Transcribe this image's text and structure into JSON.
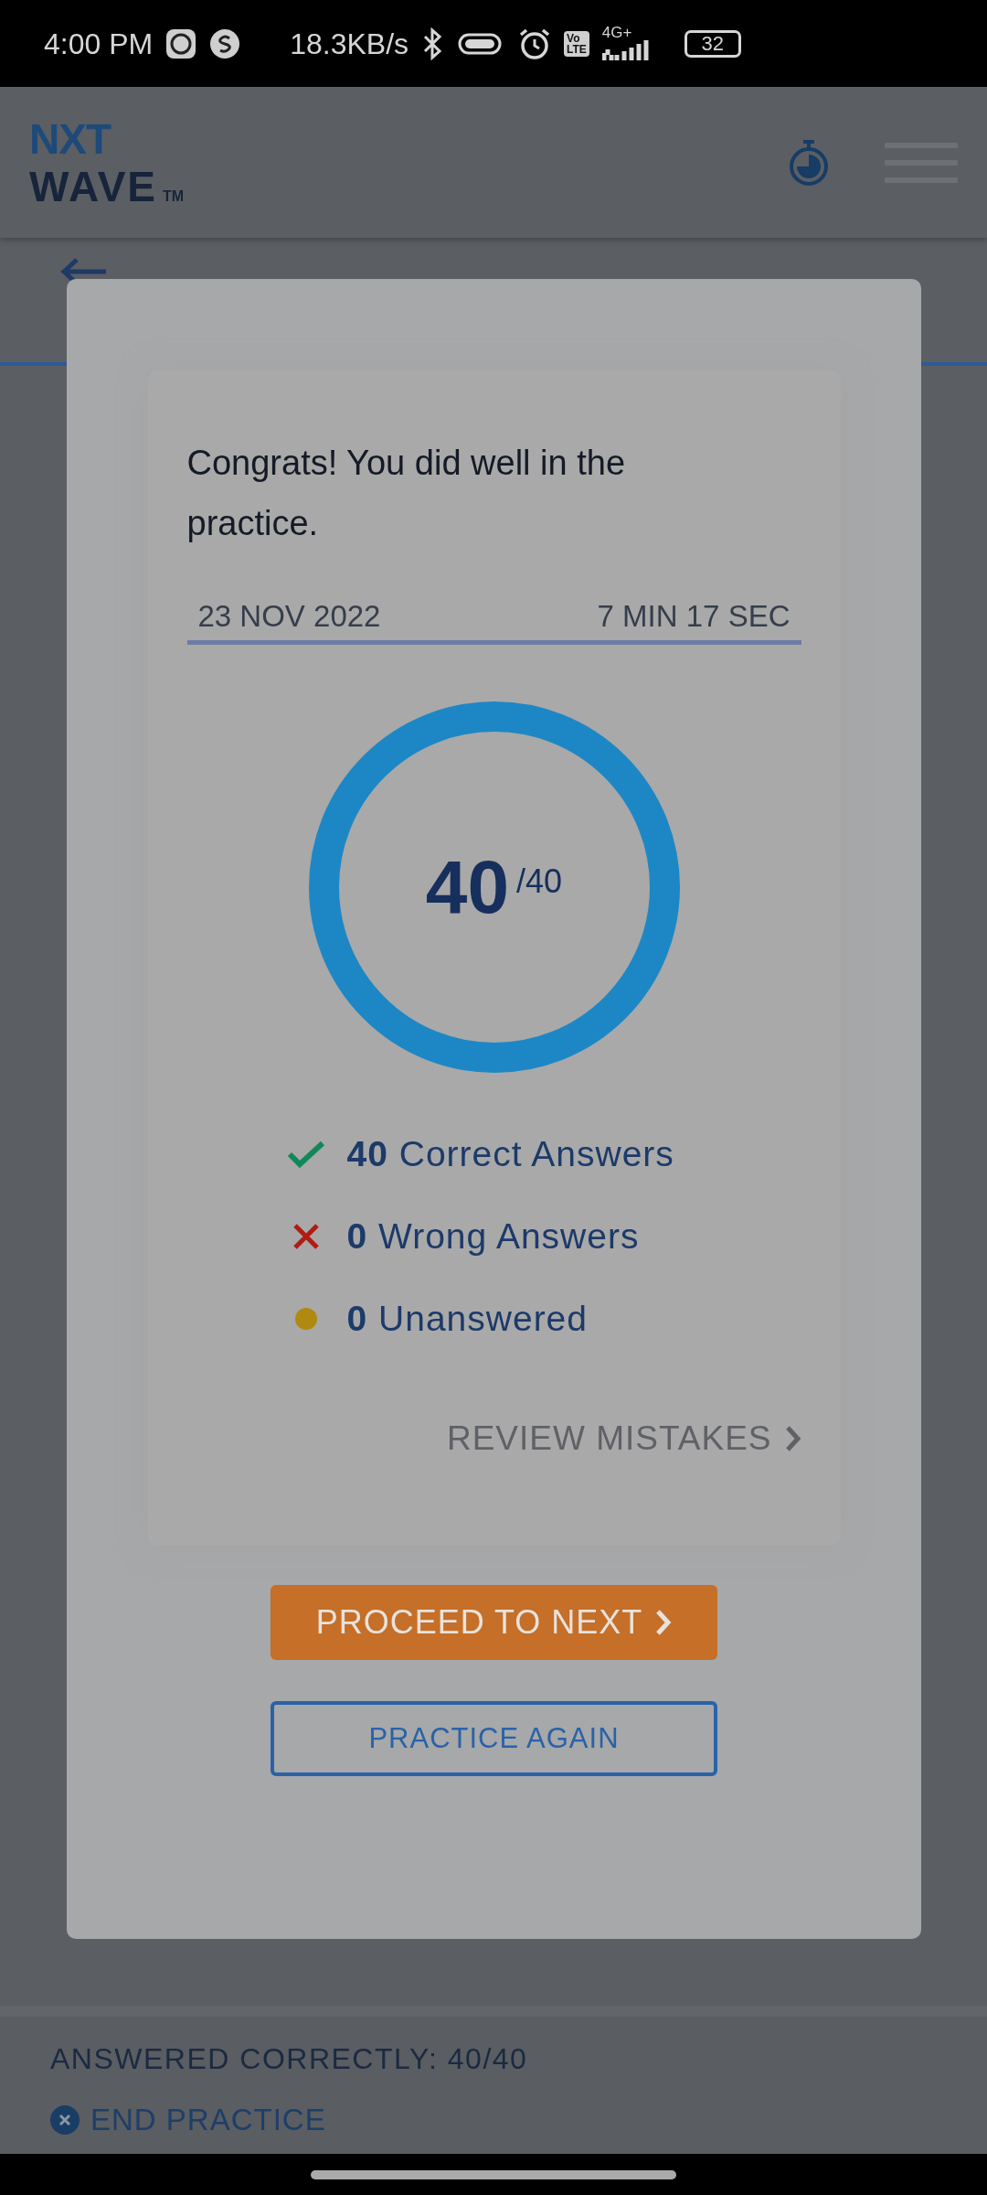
{
  "status_bar": {
    "time": "4:00 PM",
    "network_speed": "18.3KB/s",
    "volte": [
      "Vo",
      "LTE"
    ],
    "network_type": "4G+",
    "battery": "32"
  },
  "header": {
    "logo": {
      "line_1": "NXT",
      "line_2": "WAVE",
      "trademark": "TM"
    }
  },
  "result_dialog": {
    "message": "Congrats! You did well in the practice.",
    "date": "23 NOV 2022",
    "duration": "7 MIN 17 SEC",
    "score": {
      "value": "40",
      "total": "/40"
    },
    "stats": [
      {
        "kind": "correct",
        "count": "40",
        "label": "Correct Answers"
      },
      {
        "kind": "wrong",
        "count": "0",
        "label": "Wrong Answers"
      },
      {
        "kind": "unanswered",
        "count": "0",
        "label": "Unanswered"
      }
    ],
    "review_link": "REVIEW MISTAKES",
    "primary_button": "PROCEED TO NEXT",
    "secondary_button": "PRACTICE AGAIN"
  },
  "footer": {
    "summary": "ANSWERED CORRECTLY: 40/40",
    "end_button": "END PRACTICE"
  }
}
